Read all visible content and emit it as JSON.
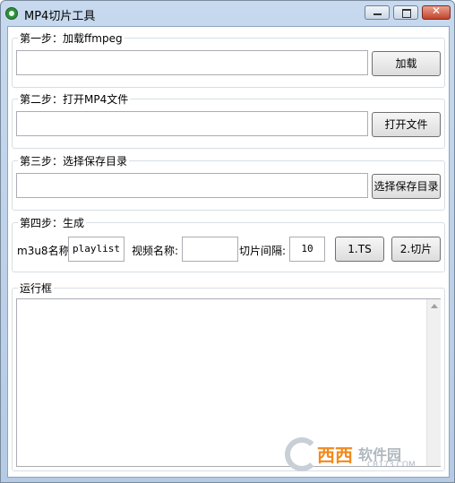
{
  "window": {
    "title": "MP4切片工具",
    "close_glyph": "✕"
  },
  "step1": {
    "title": "第一步：加载ffmpeg",
    "input_value": "",
    "button_label": "加载"
  },
  "step2": {
    "title": "第二步：打开MP4文件",
    "input_value": "",
    "button_label": "打开文件"
  },
  "step3": {
    "title": "第三步：选择保存目录",
    "input_value": "",
    "button_label": "选择保存目录"
  },
  "step4": {
    "title": "第四步：生成",
    "m3u8_label": "m3u8名称:",
    "m3u8_value": "playlist",
    "video_name_label": "视频名称:",
    "video_name_value": "",
    "slice_interval_label": "切片间隔:",
    "slice_interval_value": "10",
    "ts_button_label": "1.TS",
    "slice_button_label": "2.切片"
  },
  "log": {
    "title": "运行框",
    "content": ""
  },
  "watermark": {
    "brand": "西西",
    "site": "软件园",
    "domain": "CR173.COM"
  },
  "colors": {
    "titlebar": "#c6d9ee",
    "close_button": "#c2432b",
    "watermark_orange": "#f28a1c"
  }
}
